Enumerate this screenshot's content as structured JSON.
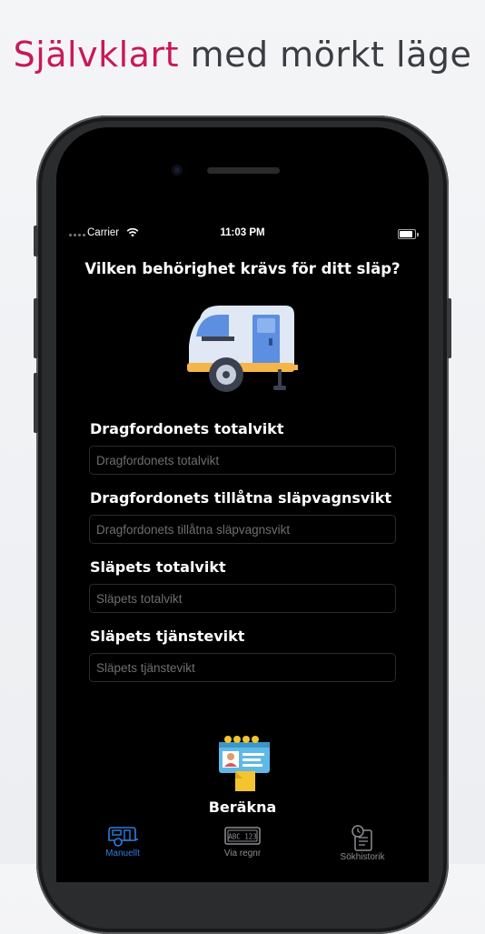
{
  "headline": {
    "accent": "Självklart",
    "rest": " med mörkt läge"
  },
  "status_bar": {
    "carrier": "Carrier",
    "time": "11:03 PM"
  },
  "question": "Vilken behörighet krävs för ditt släp?",
  "fields": [
    {
      "label": "Dragfordonets totalvikt",
      "placeholder": "Dragfordonets totalvikt",
      "value": ""
    },
    {
      "label": "Dragfordonets tillåtna släpvagnsvikt",
      "placeholder": "Dragfordonets tillåtna släpvagnsvikt",
      "value": ""
    },
    {
      "label": "Släpets totalvikt",
      "placeholder": "Släpets totalvikt",
      "value": ""
    },
    {
      "label": "Släpets tjänstevikt",
      "placeholder": "Släpets tjänstevikt",
      "value": ""
    }
  ],
  "calculate_label": "Beräkna",
  "tabs": [
    {
      "label": "Manuellt",
      "icon": "caravan-icon",
      "active": true
    },
    {
      "label": "Via regnr",
      "icon": "license-plate-icon",
      "active": false
    },
    {
      "label": "Sökhistorik",
      "icon": "history-icon",
      "active": false
    }
  ],
  "plate_text": "ABC 123",
  "colors": {
    "accent": "#c8185a",
    "tab_active": "#2f7de0",
    "background": "#000000"
  }
}
